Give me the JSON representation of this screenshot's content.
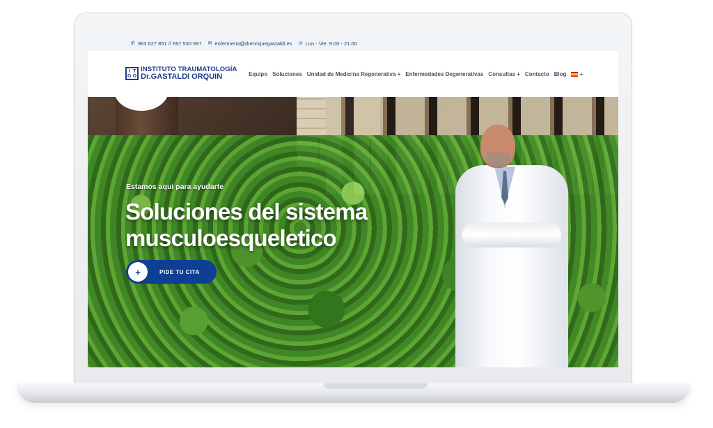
{
  "topbar": {
    "phone": "963 627 851 // 697 530 697",
    "email": "enfermeria@drenriquegastaldi.es",
    "hours": "Lun - Vie: 9.00 - 21.00",
    "phone_icon": "phone-icon",
    "email_icon": "envelope-icon",
    "hours_icon": "clock-icon"
  },
  "logo": {
    "letters": [
      "I",
      "T",
      "G",
      "O"
    ],
    "line1": "INSTITUTO TRAUMATOLOGÍA",
    "line2": "Dr.GASTALDI ORQUIN"
  },
  "nav": {
    "items": [
      "Equipo",
      "Soluciones",
      "Unidad de Medicina Regenerativa +",
      "Enfermedades Degenerativas",
      "Consultas +",
      "Contacto",
      "Blog"
    ],
    "language_suffix": "+"
  },
  "hero": {
    "kicker": "Estamos aquí para ayudarte",
    "title": "Soluciones del sistema musculoesqueletico",
    "cta_icon": "+",
    "cta_label": "PIDE TU CITA"
  },
  "colors": {
    "brand": "#1e3a8a",
    "cta": "#0f3f95",
    "topbar_bg": "#eef5fa"
  }
}
